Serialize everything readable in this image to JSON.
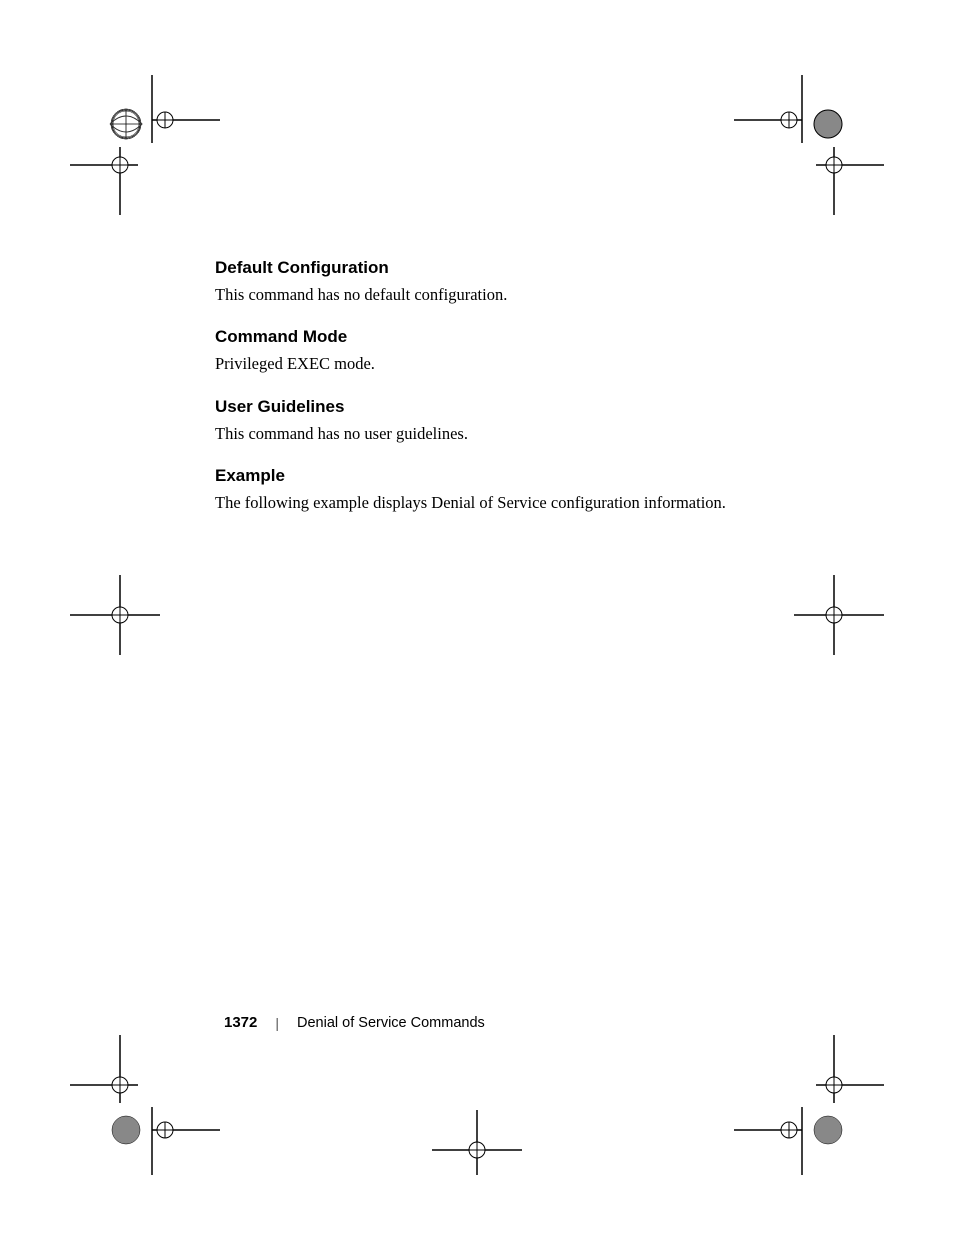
{
  "sections": {
    "defaultConfig": {
      "heading": "Default Configuration",
      "body": "This command has no default configuration."
    },
    "commandMode": {
      "heading": "Command Mode",
      "body": "Privileged EXEC mode."
    },
    "userGuidelines": {
      "heading": "User Guidelines",
      "body": "This command has no user guidelines."
    },
    "example": {
      "heading": "Example",
      "body": "The following example displays Denial of Service configuration information."
    }
  },
  "footer": {
    "pageNumber": "1372",
    "divider": "|",
    "chapterTitle": "Denial of Service Commands"
  }
}
